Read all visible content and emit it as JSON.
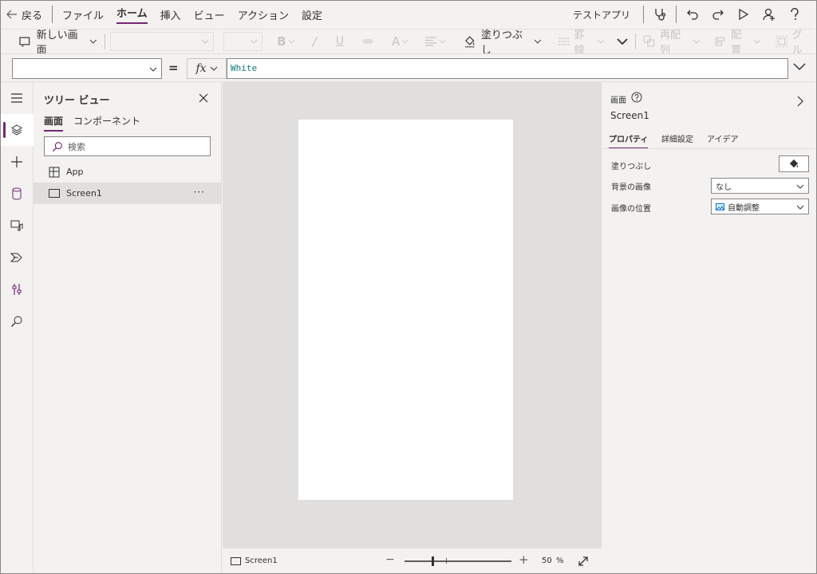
{
  "menubar": {
    "back_label": "戻る",
    "items": [
      "ファイル",
      "ホーム",
      "挿入",
      "ビュー",
      "アクション",
      "設定"
    ],
    "active": "ホーム",
    "test_app": "テストアプリ"
  },
  "toolbar": {
    "new_screen": "新しい画面",
    "fill": "塗りつぶし",
    "border": "罫線",
    "reorder": "再配列",
    "align": "配置",
    "group": "グル"
  },
  "formula": {
    "property": "",
    "equals": "=",
    "fx": "fx",
    "value": "White"
  },
  "tree": {
    "title": "ツリー ビュー",
    "tab_screens": "画面",
    "tab_components": "コンポーネント",
    "search_placeholder": "検索",
    "items": [
      {
        "label": "App"
      },
      {
        "label": "Screen1"
      }
    ],
    "more": "···"
  },
  "status": {
    "screen": "Screen1",
    "zoom_value": "50",
    "zoom_unit": "%",
    "zoom_level": 0.5
  },
  "properties": {
    "type_label": "画面",
    "name": "Screen1",
    "tabs": [
      "プロパティ",
      "詳細設定",
      "アイデア"
    ],
    "fill_label": "塗りつぶし",
    "bg_image_label": "背景の画像",
    "bg_image_value": "なし",
    "image_pos_label": "画像の位置",
    "image_pos_value": "自動調整"
  },
  "colors": {
    "accent": "#742774",
    "formula_text": "#0b7a75",
    "canvas": "#e1dfdd",
    "screen_fill": "#ffffff"
  }
}
